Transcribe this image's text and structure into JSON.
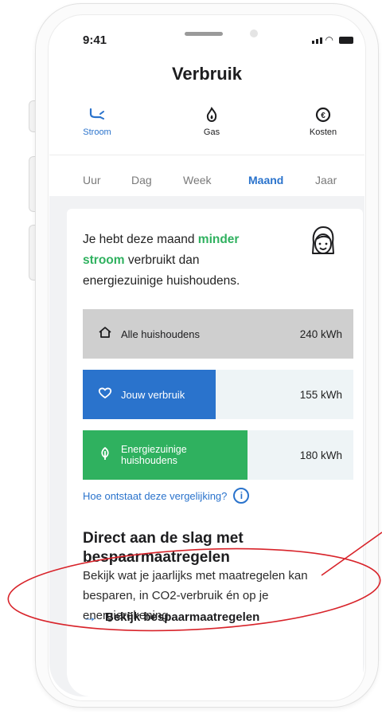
{
  "status_bar": {
    "time": "9:41"
  },
  "header": {
    "title": "Verbruik"
  },
  "energy_tabs": [
    {
      "label": "Stroom",
      "icon": "plug-icon",
      "active": true
    },
    {
      "label": "Gas",
      "icon": "flame-icon",
      "active": false
    },
    {
      "label": "Kosten",
      "icon": "euro-icon",
      "active": false
    }
  ],
  "period_tabs": [
    {
      "label": "Uur",
      "active": false
    },
    {
      "label": "Dag",
      "active": false
    },
    {
      "label": "Week",
      "active": false
    },
    {
      "label": "Maand",
      "active": true
    },
    {
      "label": "Jaar",
      "active": false
    }
  ],
  "comparison": {
    "intro_prefix": "Je hebt deze maand ",
    "intro_highlight": "minder stroom",
    "intro_suffix": " verbruikt dan energiezuinige huishoudens.",
    "rows": [
      {
        "label": "Alle huishoudens",
        "value": "240 kWh",
        "icon": "house-icon",
        "fill_fraction": 1.0,
        "color": "#cfcfcf",
        "label_color": "#1d1d1f"
      },
      {
        "label": "Jouw verbruik",
        "value": "155 kWh",
        "icon": "heart-icon",
        "fill_fraction": 0.49,
        "color": "#2a73cc",
        "label_color": "#ffffff"
      },
      {
        "label_line1": "Energiezuinige",
        "label_line2": "huishoudens",
        "value": "180 kWh",
        "icon": "leaf-icon",
        "fill_fraction": 0.61,
        "color": "#2fb15f",
        "label_color": "#ffffff"
      }
    ],
    "info_link": "Hoe ontstaat deze vergelijking?"
  },
  "savings": {
    "heading": "Direct aan de slag met bespaarmaatregelen",
    "body": "Bekijk wat je jaarlijks met maatregelen kan besparen, in CO2-verbruik én op je energierekening.",
    "cta": "Bekijk bespaarmaatregelen"
  },
  "colors": {
    "accent": "#2a73cc",
    "green": "#2fb15f",
    "annotation": "#d8232a"
  }
}
